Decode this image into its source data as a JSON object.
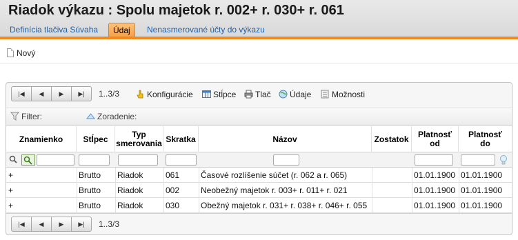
{
  "page": {
    "title": "Riadok výkazu :  Spolu majetok r. 002+ r. 030+ r. 061"
  },
  "tabs": [
    {
      "label": "Definícia tlačiva Súvaha"
    },
    {
      "label": "Údaj"
    },
    {
      "label": "Nenasmerované účty do výkazu"
    }
  ],
  "toolbar": {
    "new_label": "Nový",
    "new_icon": "document-icon"
  },
  "pager": {
    "count": "1..3/3"
  },
  "grid_toolbar": {
    "configuration": "Konfigurácie",
    "columns": "Stĺpce",
    "print": "Tlač",
    "data": "Údaje",
    "options": "Možnosti"
  },
  "filterbar": {
    "filter": "Filter:",
    "sorting": "Zoradenie:"
  },
  "columns": {
    "sign": "Znamienko",
    "column": "Stĺpec",
    "direction_type_1": "Typ",
    "direction_type_2": "smerovania",
    "abbrev": "Skratka",
    "name": "Názov",
    "balance": "Zostatok",
    "valid_from_1": "Platnosť",
    "valid_from_2": "od",
    "valid_to_1": "Platnosť",
    "valid_to_2": "do"
  },
  "rows": [
    {
      "sign": "+",
      "column": "Brutto",
      "type": "Riadok",
      "abbrev": "061",
      "name": "Časové rozlíšenie súčet (r. 062 a r. 065)",
      "balance": "",
      "from": "01.01.1900",
      "to": "01.01.1900"
    },
    {
      "sign": "+",
      "column": "Brutto",
      "type": "Riadok",
      "abbrev": "002",
      "name": "Neobežný majetok r. 003+ r. 011+ r. 021",
      "balance": "",
      "from": "01.01.1900",
      "to": "01.01.1900"
    },
    {
      "sign": "+",
      "column": "Brutto",
      "type": "Riadok",
      "abbrev": "030",
      "name": "Obežný majetok r. 031+ r. 038+ r. 046+ r. 055",
      "balance": "",
      "from": "01.01.1900",
      "to": "01.01.1900"
    }
  ],
  "colors": {
    "accent": "#f28a1b",
    "link": "#1f5fa8"
  }
}
